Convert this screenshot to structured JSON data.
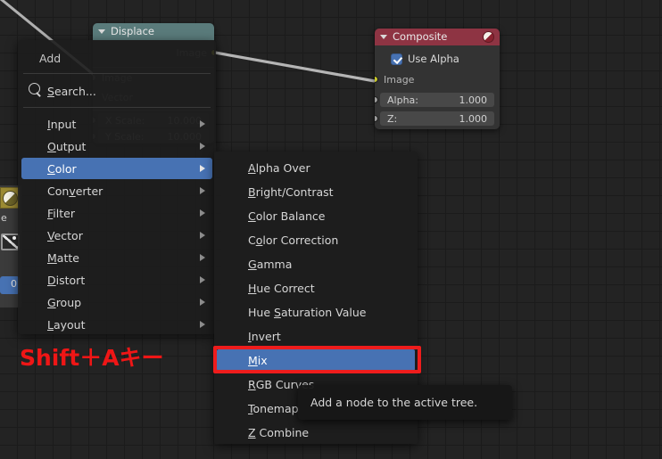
{
  "app": {
    "editor": "node-editor",
    "background_color": "#232323",
    "grid_color": "#1b1b1b",
    "accent_color": "#4772b3",
    "annotation_color": "#ee1c1c"
  },
  "annotation": {
    "shortcut_label": "Shift＋Aキー"
  },
  "tooltip": {
    "text": "Add a node to the active tree."
  },
  "left_panel": {
    "swatch_icon": "material-sphere-icon",
    "partial_text": "e",
    "image_icon": "image-icon",
    "blue_badge_text": "0"
  },
  "nodes": [
    {
      "id": "displace",
      "title": "Displace",
      "header_color": "#5a7b7b",
      "collapse_icon": "triangle-down-icon",
      "outputs": [
        {
          "name": "Image",
          "socket": "image-socket",
          "socket_color": "#c7c729"
        }
      ],
      "inputs": [
        {
          "name": "Image",
          "socket": "image-socket",
          "socket_color": "#9a9a9a"
        },
        {
          "name": "Vector",
          "socket": "vector-socket",
          "socket_color": "#9a9a9a"
        }
      ],
      "fields": [
        {
          "label": "X Scale:",
          "value": "10.000"
        },
        {
          "label": "Y Scale:",
          "value": "10.000"
        }
      ]
    },
    {
      "id": "composite",
      "title": "Composite",
      "header_color": "#8e3443",
      "collapse_icon": "triangle-down-icon",
      "header_icon": "composite-output-icon",
      "checkbox": {
        "label": "Use Alpha",
        "checked": true
      },
      "inputs": [
        {
          "name": "Image",
          "socket": "image-socket",
          "socket_color": "#c7c729"
        }
      ],
      "fields": [
        {
          "label": "Alpha:",
          "value": "1.000",
          "socket_color": "#9a9a9a"
        },
        {
          "label": "Z:",
          "value": "1.000",
          "socket_color": "#9a9a9a"
        }
      ]
    }
  ],
  "add_menu": {
    "title": "Add",
    "search": {
      "icon": "search-icon",
      "label": "Search...",
      "mnemonic": "S"
    },
    "items": [
      {
        "label": "Input",
        "mnemonic": "I",
        "has_submenu": true,
        "selected": false
      },
      {
        "label": "Output",
        "mnemonic": "O",
        "has_submenu": true,
        "selected": false
      },
      {
        "label": "Color",
        "mnemonic": "C",
        "has_submenu": true,
        "selected": true
      },
      {
        "label": "Converter",
        "mnemonic": "v",
        "has_submenu": true,
        "selected": false
      },
      {
        "label": "Filter",
        "mnemonic": "F",
        "has_submenu": true,
        "selected": false
      },
      {
        "label": "Vector",
        "mnemonic": "V",
        "has_submenu": true,
        "selected": false
      },
      {
        "label": "Matte",
        "mnemonic": "M",
        "has_submenu": true,
        "selected": false
      },
      {
        "label": "Distort",
        "mnemonic": "D",
        "has_submenu": true,
        "selected": false
      },
      {
        "label": "Group",
        "mnemonic": "G",
        "has_submenu": true,
        "selected": false
      },
      {
        "label": "Layout",
        "mnemonic": "L",
        "has_submenu": true,
        "selected": false
      }
    ]
  },
  "color_submenu": {
    "items": [
      {
        "label": "Alpha Over",
        "mnemonic": "A",
        "selected": false
      },
      {
        "label": "Bright/Contrast",
        "mnemonic": "B",
        "selected": false
      },
      {
        "label": "Color Balance",
        "mnemonic": "C",
        "selected": false
      },
      {
        "label": "Color Correction",
        "mnemonic": "o",
        "selected": false
      },
      {
        "label": "Gamma",
        "mnemonic": "G",
        "selected": false
      },
      {
        "label": "Hue Correct",
        "mnemonic": "H",
        "selected": false
      },
      {
        "label": "Hue Saturation Value",
        "mnemonic": "S",
        "selected": false
      },
      {
        "label": "Invert",
        "mnemonic": "I",
        "selected": false
      },
      {
        "label": "Mix",
        "mnemonic": "M",
        "selected": true
      },
      {
        "label": "RGB Curves",
        "mnemonic": "R",
        "selected": false
      },
      {
        "label": "Tonemap",
        "mnemonic": "T",
        "selected": false
      },
      {
        "label": "Z Combine",
        "mnemonic": "Z",
        "selected": false
      }
    ]
  }
}
